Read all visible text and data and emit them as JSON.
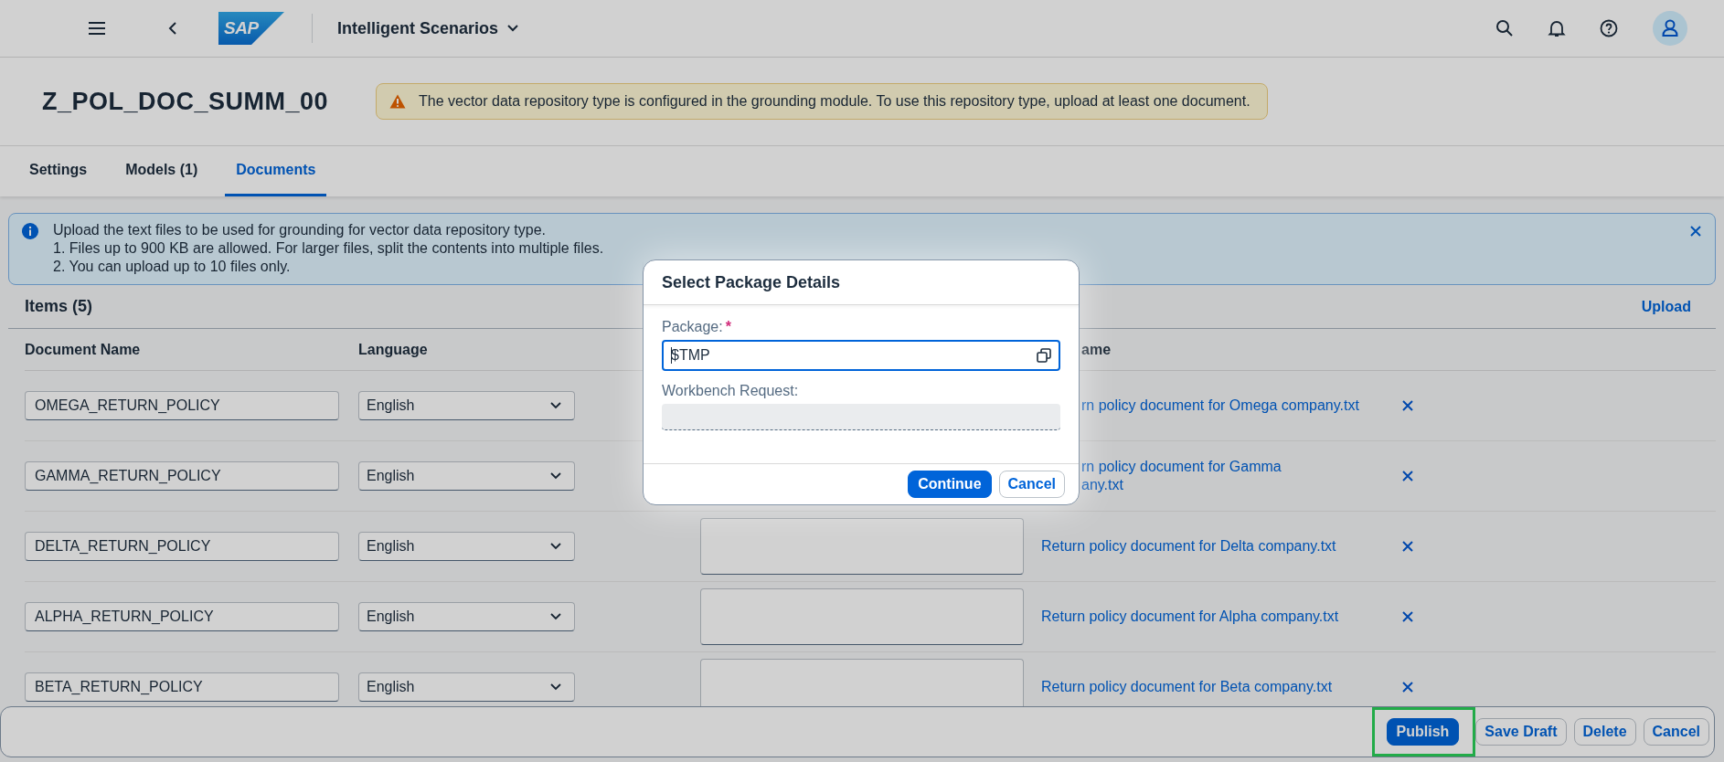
{
  "shell": {
    "logo": "SAP",
    "title": "Intelligent Scenarios"
  },
  "page": {
    "title": "Z_POL_DOC_SUMM_00",
    "warning": "The vector data repository type is configured in the grounding module. To use this repository type, upload at least one document."
  },
  "tabs": [
    {
      "label": "Settings",
      "selected": false
    },
    {
      "label": "Models (1)",
      "selected": false
    },
    {
      "label": "Documents",
      "selected": true
    }
  ],
  "info": {
    "lines": [
      "Upload the text files to be used for grounding for vector data repository type.",
      "1. Files up to 900 KB are allowed. For larger files, split the contents into multiple files.",
      "2. You can upload up to 10 files only."
    ]
  },
  "items": {
    "title": "Items (5)",
    "action": "Upload",
    "columns": [
      "Document Name",
      "Language",
      "ame"
    ],
    "rows": [
      {
        "name": "OMEGA_RETURN_POLICY",
        "language": "English",
        "file": "rn policy document for Omega company.txt",
        "covered": true
      },
      {
        "name": "GAMMA_RETURN_POLICY",
        "language": "English",
        "file": "rn policy document for Gamma\nany.txt",
        "covered": true
      },
      {
        "name": "DELTA_RETURN_POLICY",
        "language": "English",
        "file": "Return policy document for Delta company.txt",
        "covered": false
      },
      {
        "name": "ALPHA_RETURN_POLICY",
        "language": "English",
        "file": "Return policy document for Alpha company.txt",
        "covered": false
      },
      {
        "name": "BETA_RETURN_POLICY",
        "language": "English",
        "file": "Return policy document for Beta company.txt",
        "covered": false
      }
    ]
  },
  "dialog": {
    "title": "Select Package Details",
    "fields": [
      {
        "label": "Package:",
        "required_mark": "*",
        "value": "$TMP",
        "kind": "value-help"
      },
      {
        "label": "Workbench Request:",
        "kind": "disabled"
      }
    ],
    "buttons": [
      {
        "label": "Continue",
        "emphasized": true
      },
      {
        "label": "Cancel",
        "emphasized": false
      }
    ]
  },
  "footer": {
    "buttons": [
      {
        "label": "Publish",
        "emphasized": true,
        "highlighted": true
      },
      {
        "label": "Save Draft",
        "emphasized": false,
        "highlighted": false
      },
      {
        "label": "Delete",
        "emphasized": false,
        "highlighted": false
      },
      {
        "label": "Cancel",
        "emphasized": false,
        "highlighted": false
      }
    ]
  }
}
